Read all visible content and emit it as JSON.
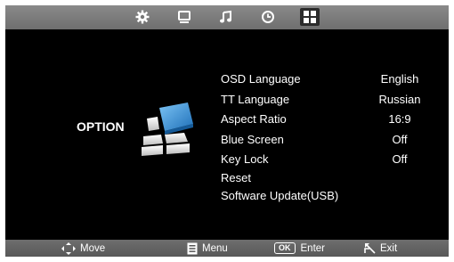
{
  "top_tabs": [
    {
      "icon": "gear-icon",
      "active": false
    },
    {
      "icon": "monitor-icon",
      "active": false
    },
    {
      "icon": "music-note-icon",
      "active": false
    },
    {
      "icon": "clock-icon",
      "active": false
    },
    {
      "icon": "grid-icon",
      "active": true
    }
  ],
  "section": {
    "title": "OPTION",
    "graphic_icon": "option-blocks-icon"
  },
  "menu": {
    "items": [
      {
        "label": "OSD Language",
        "value": "English"
      },
      {
        "label": "TT Language",
        "value": "Russian"
      },
      {
        "label": "Aspect Ratio",
        "value": "16:9"
      },
      {
        "label": "Blue Screen",
        "value": "Off"
      },
      {
        "label": "Key Lock",
        "value": "Off"
      },
      {
        "label": "Reset",
        "value": ""
      },
      {
        "label": "Software Update(USB)",
        "value": ""
      }
    ]
  },
  "footer": {
    "move": "Move",
    "menu": "Menu",
    "ok_key": "OK",
    "enter": "Enter",
    "exit": "Exit"
  },
  "colors": {
    "background": "#000000",
    "bar": "#7a7a7a",
    "accent_blue": "#3a8fd6",
    "text": "#ffffff"
  }
}
